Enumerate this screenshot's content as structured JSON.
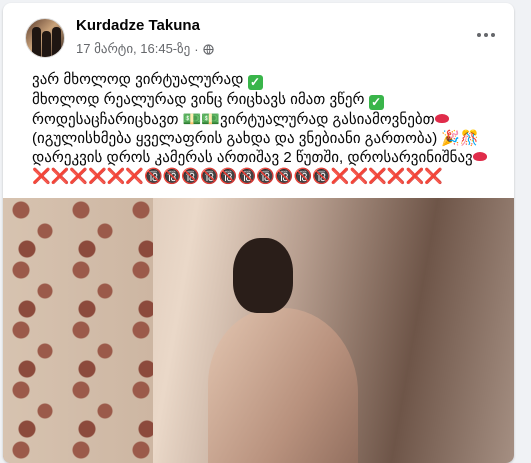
{
  "post": {
    "author": "Kurdadze Takuna",
    "timestamp": "17 მარტი, 16:45-ზე",
    "separator": "·",
    "visibility_icon": "globe-icon",
    "more_icon": "more-options-icon",
    "lines": [
      {
        "text": "ვარ მხოლოდ ვირტუალურად",
        "emoji_after": "check-mark-icon"
      },
      {
        "text": "მხოლოდ რეალურად ვინც რიცხავს იმათ ვწერ",
        "emoji_after": "check-mark-icon"
      },
      {
        "text": "როდესაცჩარიცხავთ 💵💵ვირტუალურად გასიამოვნებთ",
        "emoji_after": "lips-icon"
      },
      {
        "text": "(იგულისხმება ყველაფრის გახდა და ვნებიანი გართობა) 🎉🎊",
        "emoji_after": ""
      },
      {
        "text": "დარეკვის დროს კამერას ართიშავ 2 წუთში, დროსარვინიშნავ",
        "emoji_after": "lips-icon"
      },
      {
        "text": "❌❌❌❌❌❌🔞🔞🔞🔞🔞🔞🔞🔞🔞🔞❌❌❌❌❌❌",
        "emoji_after": ""
      }
    ]
  },
  "colors": {
    "text": "#050505",
    "secondary": "#65676b",
    "background": "#f0f2f5",
    "card": "#ffffff"
  }
}
